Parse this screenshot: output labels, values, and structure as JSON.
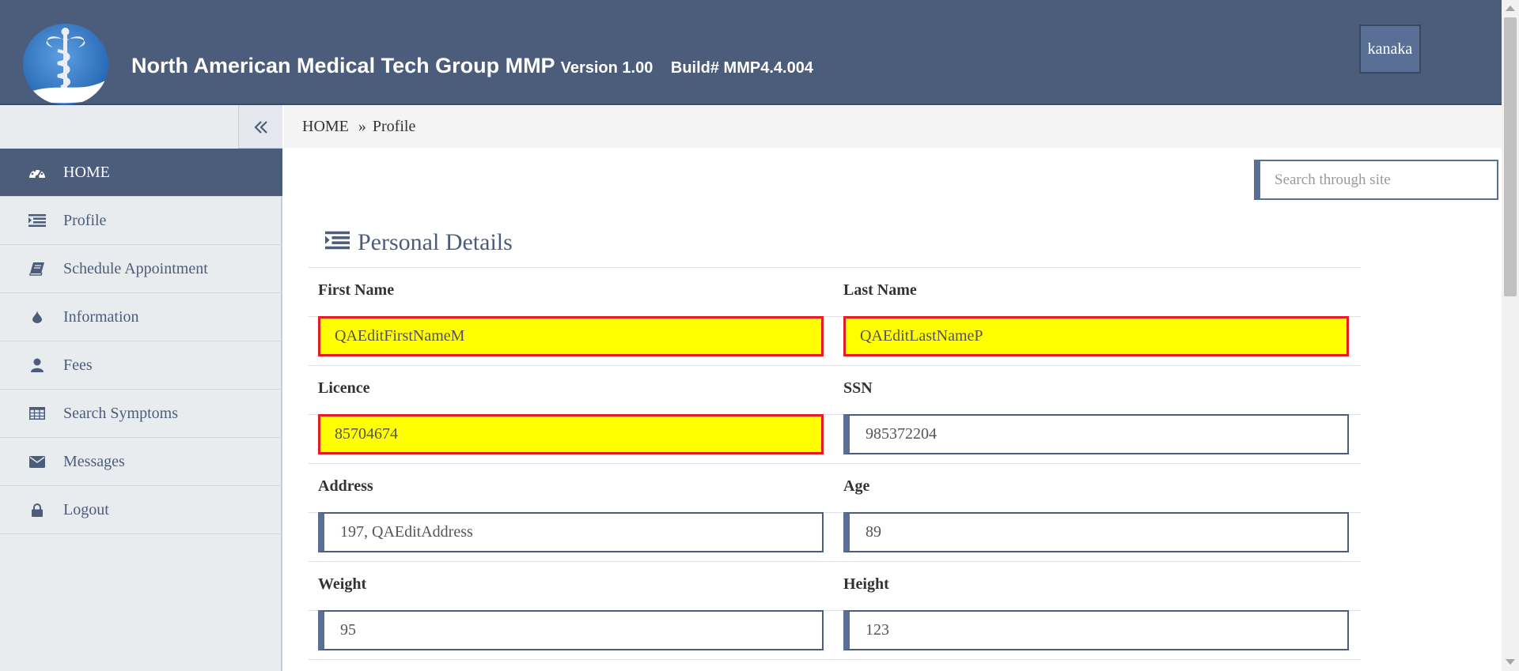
{
  "header": {
    "title": "North American Medical Tech Group MMP",
    "version": "Version 1.00",
    "build": "Build# MMP4.4.004",
    "user": "kanaka"
  },
  "sidebar": {
    "items": [
      {
        "label": "HOME",
        "icon": "dashboard-icon",
        "active": true
      },
      {
        "label": "Profile",
        "icon": "list-icon"
      },
      {
        "label": "Schedule Appointment",
        "icon": "book-icon"
      },
      {
        "label": "Information",
        "icon": "drop-icon"
      },
      {
        "label": "Fees",
        "icon": "user-icon"
      },
      {
        "label": "Search Symptoms",
        "icon": "table-icon"
      },
      {
        "label": "Messages",
        "icon": "envelope-icon"
      },
      {
        "label": "Logout",
        "icon": "lock-icon"
      }
    ]
  },
  "breadcrumb": {
    "home": "HOME",
    "separator": "»",
    "current": "Profile"
  },
  "search": {
    "placeholder": "Search through site"
  },
  "section": {
    "title": "Personal Details"
  },
  "fields": {
    "first_name": {
      "label": "First Name",
      "value": "QAEditFirstNameM"
    },
    "last_name": {
      "label": "Last Name",
      "value": "QAEditLastNameP"
    },
    "licence": {
      "label": "Licence",
      "value": "85704674"
    },
    "ssn": {
      "label": "SSN",
      "value": "985372204"
    },
    "address": {
      "label": "Address",
      "value": "197, QAEditAddress"
    },
    "age": {
      "label": "Age",
      "value": "89"
    },
    "weight": {
      "label": "Weight",
      "value": "95"
    },
    "height": {
      "label": "Height",
      "value": "123"
    }
  },
  "colors": {
    "header": "#4c5c7b",
    "error_border": "#e51c23",
    "error_fill": "#ffff00"
  }
}
